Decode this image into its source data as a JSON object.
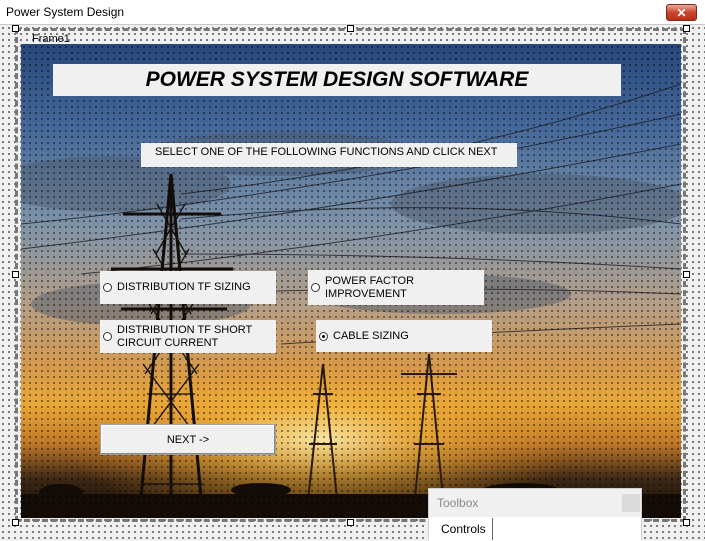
{
  "window": {
    "title": "Power System Design",
    "close_glyph": "✕"
  },
  "frame": {
    "label": "Frame1"
  },
  "form": {
    "heading": "POWER SYSTEM DESIGN SOFTWARE",
    "instruction": "SELECT ONE OF THE FOLLOWING FUNCTIONS AND CLICK NEXT",
    "options": [
      {
        "label": "DISTRIBUTION TF SIZING",
        "checked": false
      },
      {
        "label": "POWER FACTOR IMPROVEMENT",
        "checked": false
      },
      {
        "label": "DISTRIBUTION TF SHORT CIRCUIT CURRENT",
        "checked": false
      },
      {
        "label": "CABLE SIZING",
        "checked": true
      }
    ],
    "next_label": "NEXT ->"
  },
  "toolbox": {
    "title": "Toolbox",
    "tab": "Controls"
  },
  "icons": {
    "close": "close-icon",
    "radio": "radio-icon",
    "background": "power-lines-sunset-image"
  }
}
